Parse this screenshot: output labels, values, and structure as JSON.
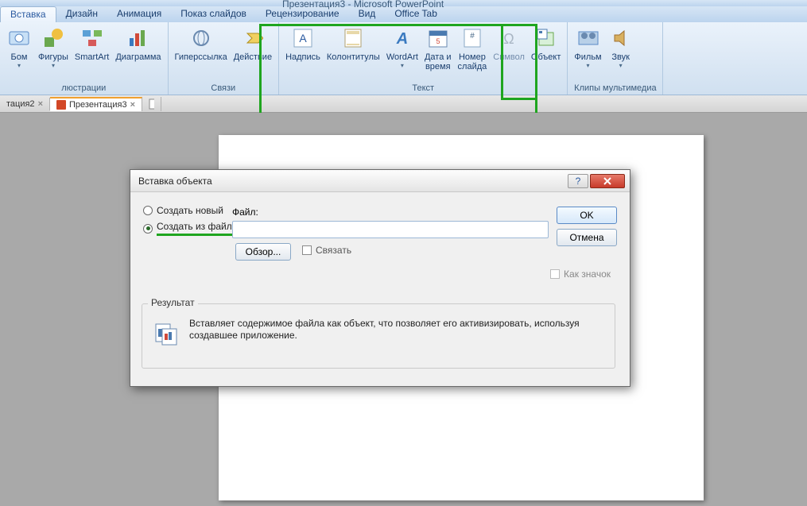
{
  "title": "Презентация3 - Microsoft PowerPoint",
  "tabs": [
    "Вставка",
    "Дизайн",
    "Анимация",
    "Показ слайдов",
    "Рецензирование",
    "Вид",
    "Office Tab"
  ],
  "active_tab": 0,
  "groups": {
    "illustrations": {
      "label": "люстрации",
      "items": [
        {
          "label": "Бом",
          "dd": true
        },
        {
          "label": "Фигуры",
          "dd": true
        },
        {
          "label": "SmartArt"
        },
        {
          "label": "Диаграмма"
        }
      ]
    },
    "links": {
      "label": "Связи",
      "items": [
        {
          "label": "Гиперссылка"
        },
        {
          "label": "Действие"
        }
      ]
    },
    "text": {
      "label": "Текст",
      "items": [
        {
          "label": "Надпись"
        },
        {
          "label": "Колонтитулы"
        },
        {
          "label": "WordArt",
          "dd": true
        },
        {
          "label": "Дата и\nвремя"
        },
        {
          "label": "Номер\nслайда"
        },
        {
          "label": "Символ"
        },
        {
          "label": "Объект"
        }
      ]
    },
    "media": {
      "label": "Клипы мультимедиа",
      "items": [
        {
          "label": "Фильм",
          "dd": true
        },
        {
          "label": "Звук",
          "dd": true
        }
      ]
    }
  },
  "doctabs": [
    {
      "label": "тация2"
    },
    {
      "label": "Презентация3",
      "active": true
    },
    {
      "label": ""
    }
  ],
  "dialog": {
    "title": "Вставка объекта",
    "radio_new": "Создать новый",
    "radio_file": "Создать из файла",
    "file_label": "Файл:",
    "browse": "Обзор...",
    "link": "Связать",
    "ok": "OK",
    "cancel": "Отмена",
    "asicon": "Как значок",
    "result_legend": "Результат",
    "result_text": "Вставляет содержимое файла как объект, что позволяет его активизировать, используя создавшее приложение."
  }
}
